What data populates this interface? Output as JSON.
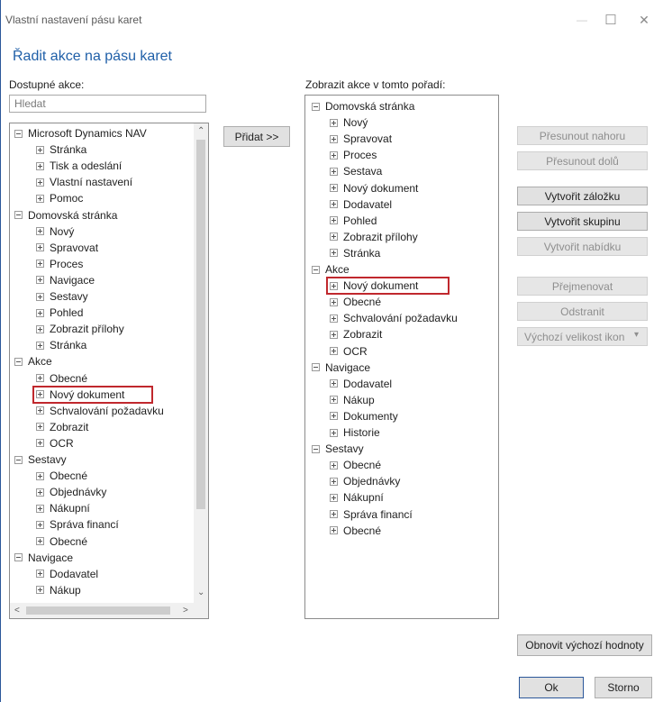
{
  "window": {
    "title": "Vlastní nastavení pásu karet",
    "minimize_glyph": "—",
    "maximize_glyph": "☐",
    "close_glyph": "✕"
  },
  "heading": "Řadit akce na pásu karet",
  "available": {
    "label": "Dostupné akce:",
    "search_placeholder": "Hledat",
    "items": [
      {
        "label": "Microsoft Dynamics NAV",
        "level": 0,
        "expander": "minus"
      },
      {
        "label": "Stránka",
        "level": 1,
        "expander": "plus"
      },
      {
        "label": "Tisk a odeslání",
        "level": 1,
        "expander": "plus"
      },
      {
        "label": "Vlastní nastavení",
        "level": 1,
        "expander": "plus"
      },
      {
        "label": "Pomoc",
        "level": 1,
        "expander": "plus"
      },
      {
        "label": "Domovská stránka",
        "level": 0,
        "expander": "minus"
      },
      {
        "label": "Nový",
        "level": 1,
        "expander": "plus"
      },
      {
        "label": "Spravovat",
        "level": 1,
        "expander": "plus"
      },
      {
        "label": "Proces",
        "level": 1,
        "expander": "plus"
      },
      {
        "label": "Navigace",
        "level": 1,
        "expander": "plus"
      },
      {
        "label": "Sestavy",
        "level": 1,
        "expander": "plus"
      },
      {
        "label": "Pohled",
        "level": 1,
        "expander": "plus"
      },
      {
        "label": "Zobrazit přílohy",
        "level": 1,
        "expander": "plus"
      },
      {
        "label": "Stránka",
        "level": 1,
        "expander": "plus"
      },
      {
        "label": "Akce",
        "level": 0,
        "expander": "minus"
      },
      {
        "label": "Obecné",
        "level": 1,
        "expander": "plus"
      },
      {
        "label": "Nový dokument",
        "level": 1,
        "expander": "plus",
        "highlighted": true
      },
      {
        "label": "Schvalování požadavku",
        "level": 1,
        "expander": "plus"
      },
      {
        "label": "Zobrazit",
        "level": 1,
        "expander": "plus"
      },
      {
        "label": "OCR",
        "level": 1,
        "expander": "plus"
      },
      {
        "label": "Sestavy",
        "level": 0,
        "expander": "minus"
      },
      {
        "label": "Obecné",
        "level": 1,
        "expander": "plus"
      },
      {
        "label": "Objednávky",
        "level": 1,
        "expander": "plus"
      },
      {
        "label": "Nákupní",
        "level": 1,
        "expander": "plus"
      },
      {
        "label": "Správa financí",
        "level": 1,
        "expander": "plus"
      },
      {
        "label": "Obecné",
        "level": 1,
        "expander": "plus"
      },
      {
        "label": "Navigace",
        "level": 0,
        "expander": "minus"
      },
      {
        "label": "Dodavatel",
        "level": 1,
        "expander": "plus"
      },
      {
        "label": "Nákup",
        "level": 1,
        "expander": "plus"
      }
    ],
    "scroll_up": "⌃",
    "scroll_down": "⌄",
    "scroll_left": "<",
    "scroll_right": ">"
  },
  "add_button": "Přidat >>",
  "order": {
    "label": "Zobrazit akce v tomto pořadí:",
    "items": [
      {
        "label": "Domovská stránka",
        "level": 0,
        "expander": "minus"
      },
      {
        "label": "Nový",
        "level": 1,
        "expander": "plus"
      },
      {
        "label": "Spravovat",
        "level": 1,
        "expander": "plus"
      },
      {
        "label": "Proces",
        "level": 1,
        "expander": "plus"
      },
      {
        "label": "Sestava",
        "level": 1,
        "expander": "plus"
      },
      {
        "label": "Nový dokument",
        "level": 1,
        "expander": "plus"
      },
      {
        "label": "Dodavatel",
        "level": 1,
        "expander": "plus"
      },
      {
        "label": "Pohled",
        "level": 1,
        "expander": "plus"
      },
      {
        "label": "Zobrazit přílohy",
        "level": 1,
        "expander": "plus"
      },
      {
        "label": "Stránka",
        "level": 1,
        "expander": "plus"
      },
      {
        "label": "Akce",
        "level": 0,
        "expander": "minus"
      },
      {
        "label": "Nový dokument",
        "level": 1,
        "expander": "plus",
        "highlighted": true
      },
      {
        "label": "Obecné",
        "level": 1,
        "expander": "plus"
      },
      {
        "label": "Schvalování požadavku",
        "level": 1,
        "expander": "plus"
      },
      {
        "label": "Zobrazit",
        "level": 1,
        "expander": "plus"
      },
      {
        "label": "OCR",
        "level": 1,
        "expander": "plus"
      },
      {
        "label": "Navigace",
        "level": 0,
        "expander": "minus"
      },
      {
        "label": "Dodavatel",
        "level": 1,
        "expander": "plus"
      },
      {
        "label": "Nákup",
        "level": 1,
        "expander": "plus"
      },
      {
        "label": "Dokumenty",
        "level": 1,
        "expander": "plus"
      },
      {
        "label": "Historie",
        "level": 1,
        "expander": "plus"
      },
      {
        "label": "Sestavy",
        "level": 0,
        "expander": "minus"
      },
      {
        "label": "Obecné",
        "level": 1,
        "expander": "plus"
      },
      {
        "label": "Objednávky",
        "level": 1,
        "expander": "plus"
      },
      {
        "label": "Nákupní",
        "level": 1,
        "expander": "plus"
      },
      {
        "label": "Správa financí",
        "level": 1,
        "expander": "plus"
      },
      {
        "label": "Obecné",
        "level": 1,
        "expander": "plus"
      }
    ]
  },
  "actions": {
    "move_up": "Přesunout nahoru",
    "move_down": "Přesunout dolů",
    "create_tab": "Vytvořit záložku",
    "create_group": "Vytvořit skupinu",
    "create_menu": "Vytvořit nabídku",
    "rename": "Přejmenovat",
    "remove": "Odstranit",
    "icon_size": "Výchozí velikost ikon",
    "icon_size_caret": "▾",
    "reset": "Obnovit výchozí hodnoty",
    "ok": "Ok",
    "cancel": "Storno"
  },
  "colors": {
    "heading": "#1f5fa8",
    "highlight": "#c0282d"
  }
}
